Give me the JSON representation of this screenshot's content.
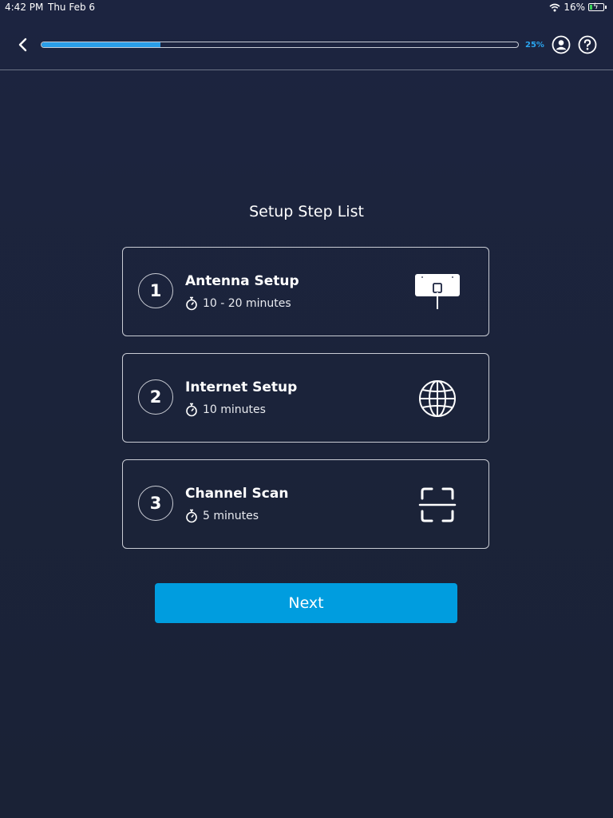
{
  "status_bar": {
    "time": "4:42 PM",
    "date": "Thu Feb 6",
    "battery_percent": "16%",
    "icons": [
      "wifi-icon",
      "battery-charging-icon"
    ]
  },
  "header": {
    "back_icon": "chevron-left-icon",
    "progress_value": 0.25,
    "progress_label": "25%",
    "account_icon": "user-circle-icon",
    "help_icon": "question-circle-icon",
    "accent_color": "#2aa5ef"
  },
  "main": {
    "title": "Setup Step List",
    "steps": [
      {
        "number": "1",
        "title": "Antenna Setup",
        "duration": "10 - 20 minutes",
        "icon": "antenna-icon"
      },
      {
        "number": "2",
        "title": "Internet Setup",
        "duration": "10 minutes",
        "icon": "globe-icon"
      },
      {
        "number": "3",
        "title": "Channel Scan",
        "duration": "5 minutes",
        "icon": "scan-frame-icon"
      }
    ],
    "next_label": "Next",
    "next_color": "#009ddf"
  }
}
